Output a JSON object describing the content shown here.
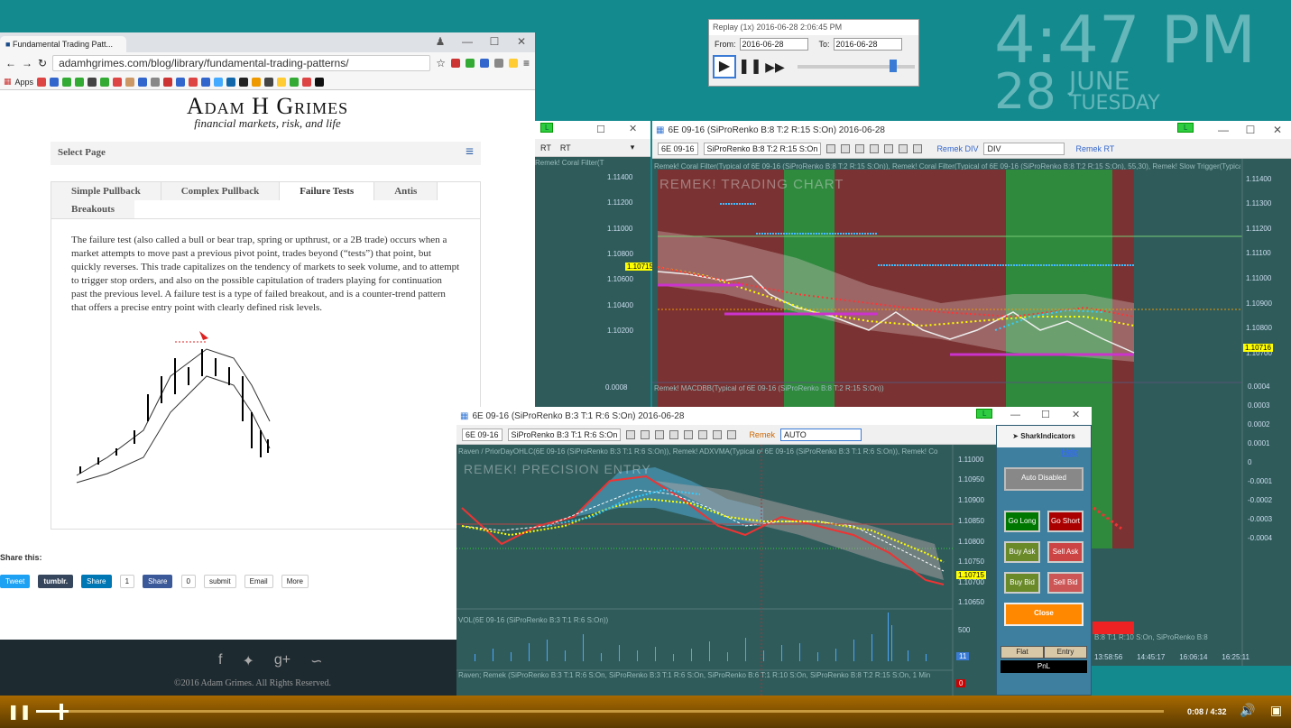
{
  "clock": {
    "time": "4:47 PM",
    "day": "28",
    "month": "JUNE",
    "weekday": "TUESDAY"
  },
  "replay": {
    "title": "Replay (1x) 2016-06-28 2:06:45 PM",
    "from_label": "From:",
    "from_value": "2016-06-28",
    "to_label": "To:",
    "to_value": "2016-06-28"
  },
  "browser": {
    "tab": "Fundamental Trading Patt...",
    "url": "adamhgrimes.com/blog/library/fundamental-trading-patterns/",
    "apps": "Apps"
  },
  "site": {
    "title": "Adam H Grimes",
    "tagline": "financial markets, risk, and life",
    "select_page": "Select Page",
    "tabs": [
      "Simple Pullback",
      "Complex Pullback",
      "Failure Tests",
      "Antis",
      "Breakouts"
    ],
    "body": "The failure test (also called a bull or bear trap, spring or upthrust, or a 2B trade) occurs when a market attempts to move past a previous pivot point, trades beyond (“tests”) that point, but quickly reverses. This trade capitalizes on the tendency of markets to seek volume, and to attempt to trigger stop orders, and also on the possible capitulation of traders playing for continuation past the previous level. A failure test is a type of failed breakout, and is a counter-trend pattern that offers a precise entry point with clearly defined risk levels.",
    "share_this": "Share this:",
    "tweet": "Tweet",
    "tumblr": "tumblr.",
    "share_in": "Share",
    "in_count": "1",
    "share_fb": "Share",
    "fb_count": "0",
    "submit": "submit",
    "email": "Email",
    "more": "More",
    "footer": "©2016 Adam Grimes. All Rights Reserved."
  },
  "chart_left": {
    "rt": "RT",
    "label": "Remek! Coral Filter(T",
    "l_badge": "L",
    "price": "1.10715",
    "levels": [
      "1.11400",
      "1.11200",
      "1.11000",
      "1.10800",
      "1.10600",
      "1.10400",
      "1.10200"
    ],
    "sub": "0.0008"
  },
  "chart_main": {
    "title": "6E 09-16 (SiProRenko B:8 T:2 R:15 S:On)  2016-06-28",
    "instr": "6E 09-16",
    "type": "SiProRenko B:8 T:2 R:15 S:On",
    "remek_div": "Remek DIV",
    "div": "DIV",
    "remek_rt": "Remek RT",
    "l_badge": "L",
    "indicators": "Remek! Coral Filter(Typical of 6E 09-16 (SiProRenko B:8 T:2 R:15 S:On)), Remek! Coral Filter(Typical of 6E 09-16 (SiProRenko B:8 T:2 R:15 S:On), 55,30), Remek! Slow Trigger(Typical of",
    "watermark": "REMEK! TRADING CHART",
    "price": "1.10716",
    "yaxis": [
      "1.11400",
      "1.11300",
      "1.11200",
      "1.11100",
      "1.11000",
      "1.10900",
      "1.10800",
      "1.10700",
      "1.10600"
    ],
    "macd_label": "Remek! MACDBB(Typical of 6E 09-16 (SiProRenko B:8 T:2 R:15 S:On))",
    "macd_axis": [
      "0.0004",
      "0.0003",
      "0.0002",
      "0.0001",
      "0",
      "-0.0001",
      "-0.0002",
      "-0.0003",
      "-0.0004"
    ],
    "bottom_label": "B:8 T:1 R:10 S:On, SiProRenko B:8",
    "times": [
      "13:58:56",
      "14:45:17",
      "16:06:14",
      "16:25:11"
    ]
  },
  "chart_entry": {
    "title": "6E 09-16 (SiProRenko B:3 T:1 R:6 S:On)  2016-06-28",
    "instr": "6E 09-16",
    "type": "SiProRenko B:3 T:1 R:6 S:On",
    "remek": "Remek",
    "auto": "AUTO",
    "l_badge": "L",
    "indicators": "Raven / PriorDayOHLC(6E 09-16 (SiProRenko B:3 T:1 R:6 S:On)), Remek! ADXVMA(Typical of 6E 09-16 (SiProRenko B:3 T:1 R:6 S:On)), Remek! Co",
    "watermark": "REMEK! PRECISION ENTRY",
    "price": "1.10715",
    "yaxis": [
      "1.11000",
      "1.10950",
      "1.10900",
      "1.10850",
      "1.10800",
      "1.10750",
      "1.10700",
      "1.10650"
    ],
    "vol_label": "VOL(6E 09-16 (SiProRenko B:3 T:1 R:6 S:On))",
    "vol_axis": "500",
    "vol_badge": "11",
    "bottom_label": "Raven; Remek (SiProRenko B:3 T:1 R:6 S:On, SiProRenko B:3 T:1 R:6 S:On, SiProRenko B:6 T:1 R:10 S:On, SiProRenko B:8 T:2 R:15 S:On, 1 Min",
    "bottom_badge": "0"
  },
  "shark": {
    "brand": "SharkIndicators",
    "help": "Help",
    "auto": "Auto Disabled",
    "go_long": "Go Long",
    "go_short": "Go Short",
    "buy_ask": "Buy Ask",
    "sell_ask": "Sell Ask",
    "buy_bid": "Buy Bid",
    "sell_bid": "Sell Bid",
    "close": "Close",
    "flat": "Flat",
    "entry": "Entry",
    "pnl": "PnL"
  },
  "player": {
    "time": "0:08 / 4:32"
  },
  "colors": {
    "desktop": "#138a8e",
    "chart_bg": "#2f5b5b",
    "red_zone": "#7a3232",
    "green_zone": "#2f8a3e"
  }
}
